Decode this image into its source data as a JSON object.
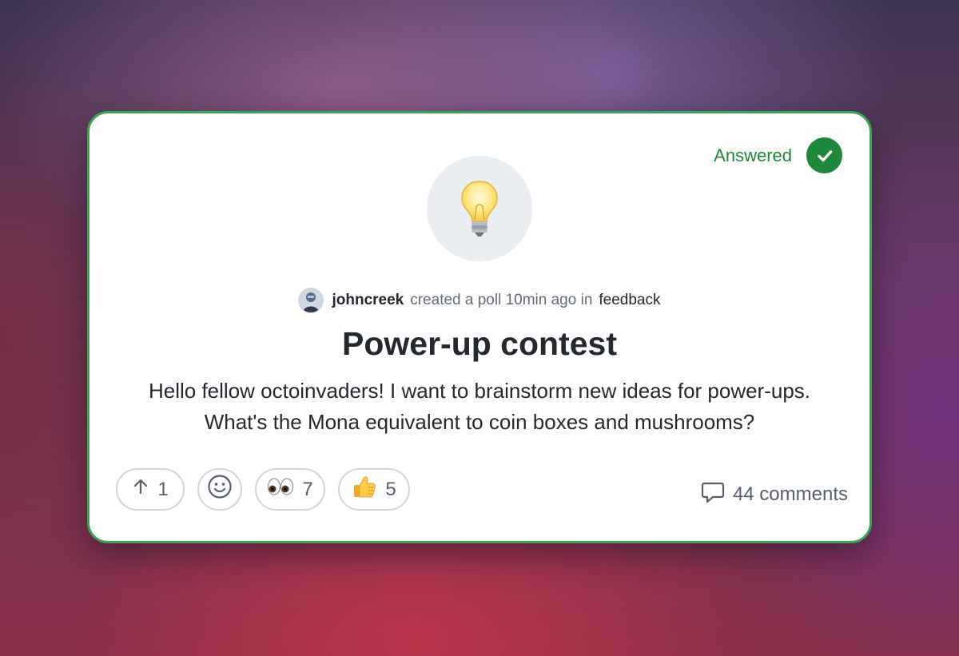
{
  "status": {
    "label": "Answered",
    "color": "#1f883d",
    "icon": "check-circle-icon"
  },
  "discussion": {
    "emoji": "light-bulb-icon",
    "author": "johncreek",
    "action_text": "created a poll 10min ago in",
    "category": "feedback",
    "title": "Power-up contest",
    "body": "Hello fellow octoinvaders! I want to brainstorm new ideas for power-ups. What's the Mona equivalent to coin boxes and mushrooms?"
  },
  "reactions": {
    "upvote": {
      "icon": "arrow-up-icon",
      "count": "1"
    },
    "add_reaction": {
      "icon": "smiley-icon"
    },
    "eyes": {
      "icon": "eyes-icon",
      "count": "7"
    },
    "thumbs_up": {
      "icon": "thumbs-up-icon",
      "count": "5"
    }
  },
  "comments": {
    "icon": "comment-icon",
    "label": "44 comments"
  },
  "colors": {
    "card_border": "#3fa154",
    "text_primary": "#24292f",
    "text_muted": "#656d76"
  }
}
